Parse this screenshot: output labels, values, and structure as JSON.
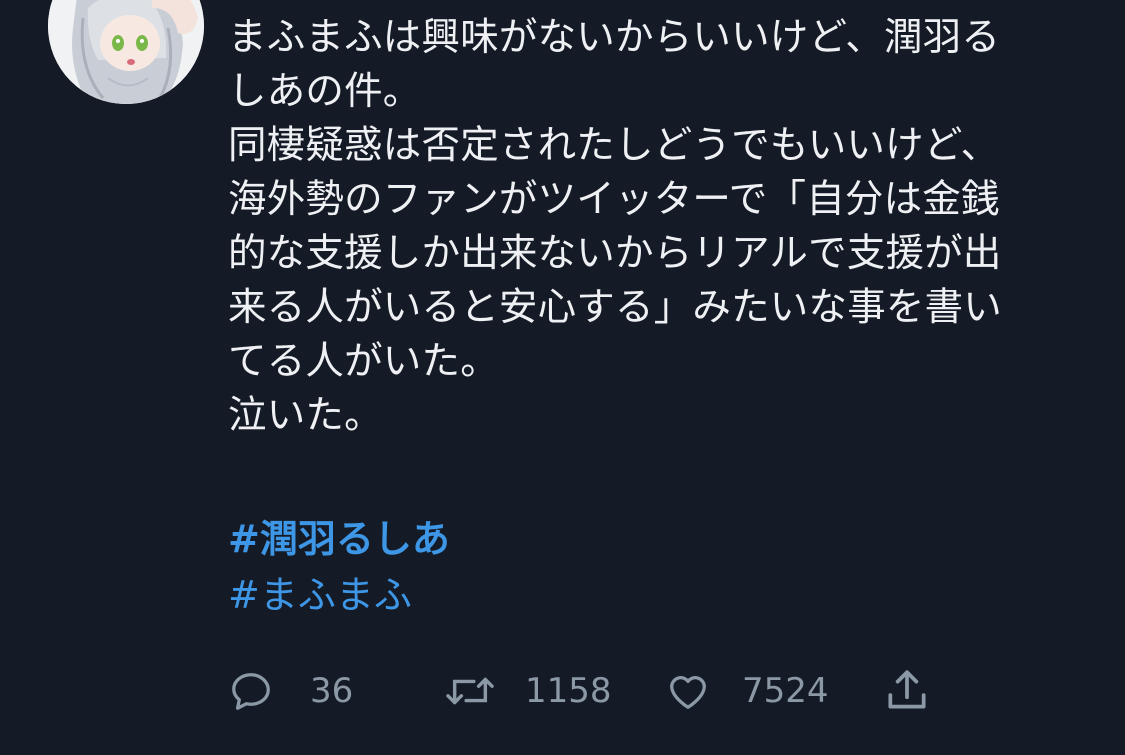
{
  "tweet": {
    "text_lines": [
      "まふまふは興味がないからいいけど、潤羽る",
      "しあの件。",
      "同棲疑惑は否定されたしどうでもいいけど、",
      "海外勢のファンがツイッターで「自分は金銭",
      "的な支援しか出来ないからリアルで支援が出",
      "来る人がいると安心する」みたいな事を書い",
      "てる人がいた。",
      "泣いた。"
    ],
    "hashtags": [
      "#潤羽るしあ",
      "#まふまふ"
    ]
  },
  "actions": {
    "reply_count": "36",
    "retweet_count": "1158",
    "like_count": "7524"
  },
  "icons": {
    "reply": "reply-bubble-icon",
    "retweet": "retweet-icon",
    "like": "heart-icon",
    "share": "share-icon"
  },
  "colors": {
    "background": "#151b26",
    "text": "#eef0f3",
    "hashtag": "#3e96e6",
    "muted": "#8b98a5"
  }
}
